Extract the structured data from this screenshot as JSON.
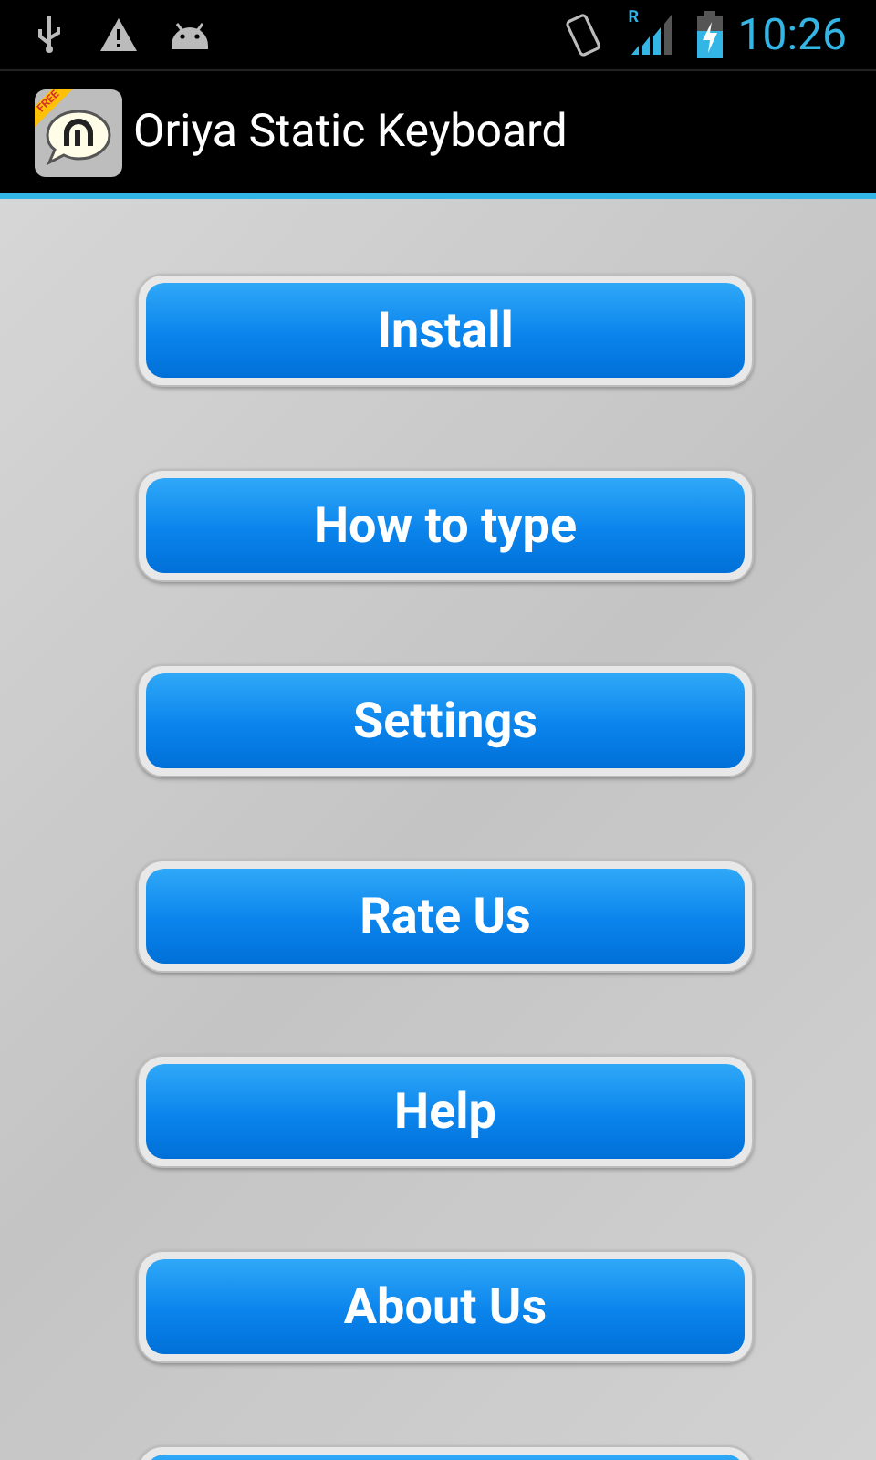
{
  "status_bar": {
    "time": "10:26",
    "signal_roaming": "R"
  },
  "action_bar": {
    "badge": "FREE",
    "title": "Oriya Static Keyboard"
  },
  "buttons": [
    {
      "kind": "full",
      "label": "Install"
    },
    {
      "kind": "full",
      "label": "How to type"
    },
    {
      "kind": "full",
      "label": "Settings"
    },
    {
      "kind": "full",
      "label": "Rate Us"
    },
    {
      "kind": "full",
      "label": "Help"
    },
    {
      "kind": "full",
      "label": "About Us"
    },
    {
      "kind": "partial"
    }
  ]
}
